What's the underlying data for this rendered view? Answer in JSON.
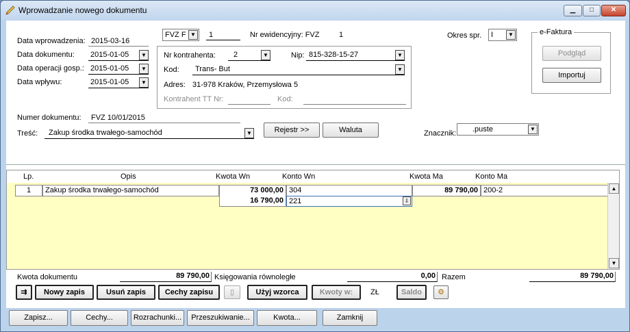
{
  "window": {
    "title": "Wprowadzanie nowego dokumentu"
  },
  "header": {
    "data_wprowadzenia_label": "Data wprowadzenia:",
    "data_wprowadzenia": "2015-03-16",
    "data_dokumentu_label": "Data dokumentu:",
    "data_dokumentu": "2015-01-05",
    "data_operacji_label": "Data operacji gosp.:",
    "data_operacji": "2015-01-05",
    "data_wplywu_label": "Data wpływu:",
    "data_wplywu": "2015-01-05",
    "typ": "FVZ  F",
    "numer": "1",
    "nr_ewidencyjny_label": "Nr ewidencyjny: FVZ",
    "nr_ewidencyjny": "1",
    "okres_label": "Okres spr.",
    "okres": "I",
    "numer_dokumentu_label": "Numer dokumentu:",
    "numer_dokumentu": "FVZ 10/01/2015",
    "tresc_label": "Treść:",
    "tresc": "Zakup środka trwałego-samochód",
    "znacznik_label": "Znacznik:",
    "znacznik": ".puste"
  },
  "kontrahent": {
    "nr_label": "Nr kontrahenta:",
    "nr": "2",
    "nip_label": "Nip:",
    "nip": "815-328-15-27",
    "kod_label": "Kod:",
    "kod": "Trans- But",
    "adres_label": "Adres:",
    "adres": "31-978 Kraków, Przemysłowa 5",
    "tt_label": "Kontrahent TT Nr:",
    "tt_kod_label": "Kod:"
  },
  "efaktura": {
    "title": "e-Faktura",
    "podglad": "Podgląd",
    "importuj": "Importuj"
  },
  "buttons": {
    "rejestr": "Rejestr >>",
    "waluta": "Waluta"
  },
  "table": {
    "headers": [
      "Lp.",
      "Opis",
      "Kwota  Wn",
      "Konto  Wn",
      "Kwota Ma",
      "Konto Ma"
    ],
    "rows": [
      {
        "lp": "1",
        "opis": "Zakup środka trwałego-samochód",
        "kwota_wn": "73 000,00",
        "konto_wn": "304",
        "kwota_ma": "89 790,00",
        "konto_ma": "200-2"
      },
      {
        "lp": "",
        "opis": "",
        "kwota_wn": "16 790,00",
        "konto_wn": "221",
        "kwota_ma": "",
        "konto_ma": ""
      }
    ]
  },
  "summary": {
    "kwota_dokumentu_label": "Kwota dokumentu",
    "kwota_dokumentu": "89 790,00",
    "ksiegowania_label": "Księgowania równoległe",
    "ksiegowania": "0,00",
    "razem_label": "Razem",
    "razem": "89 790,00"
  },
  "toolbar": {
    "nowy_zapis": "Nowy zapis",
    "usun_zapis": "Usuń zapis",
    "cechy_zapisu": "Cechy zapisu",
    "uzyj_wzorca": "Użyj wzorca",
    "kwoty_w": "Kwoty w:",
    "currency": "ZŁ",
    "saldo": "Saldo"
  },
  "bottom": {
    "zapisz": "Zapisz...",
    "cechy": "Cechy...",
    "rozrachunki": "Rozrachunki...",
    "przeszukiwanie": "Przeszukiwanie...",
    "kwota": "Kwota...",
    "zamknij": "Zamknij"
  }
}
